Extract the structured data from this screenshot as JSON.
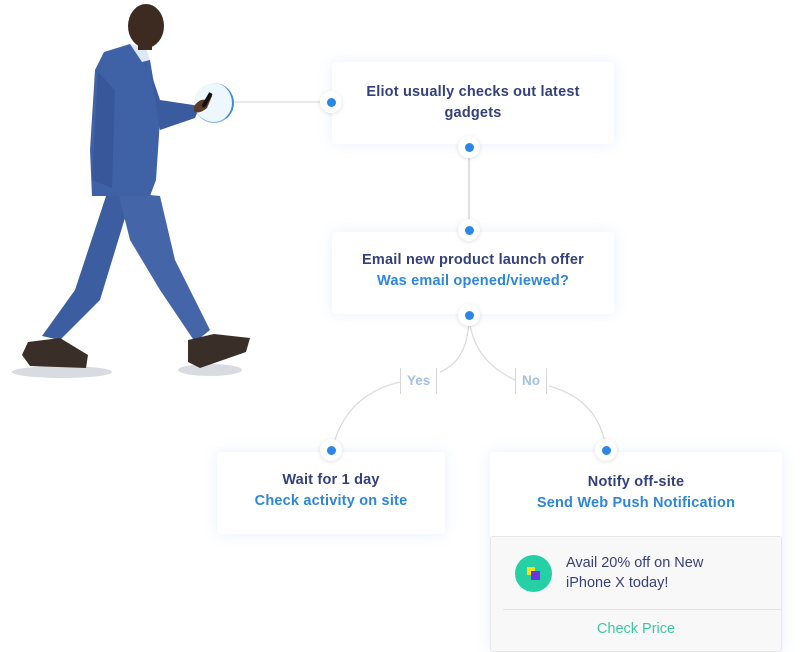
{
  "flow": {
    "nodes": [
      {
        "id": "trigger",
        "title": "Eliot usually checks out latest gadgets",
        "subtitle": null
      },
      {
        "id": "email",
        "title": "Email new product launch offer",
        "subtitle": "Was email opened/viewed?"
      },
      {
        "id": "wait",
        "title": "Wait for 1 day",
        "subtitle": "Check activity on site"
      },
      {
        "id": "notify",
        "title": "Notify off-site",
        "subtitle": "Send Web Push Notification"
      }
    ],
    "branches": {
      "yes": "Yes",
      "no": "No"
    },
    "notification": {
      "icon": "app-logo-icon",
      "message_line1": "Avail 20% off on New",
      "message_line2": "iPhone X today!",
      "action": "Check Price"
    }
  },
  "person": {
    "name": "Eliot",
    "image": "man-walking-with-phone"
  },
  "colors": {
    "accent_blue": "#2a87e8",
    "title_navy": "#34407c",
    "subtitle_blue": "#2d86dc",
    "branch_label": "#a3c0e0",
    "action_green": "#3cc9a0",
    "icon_bg": "#25d0a4"
  }
}
